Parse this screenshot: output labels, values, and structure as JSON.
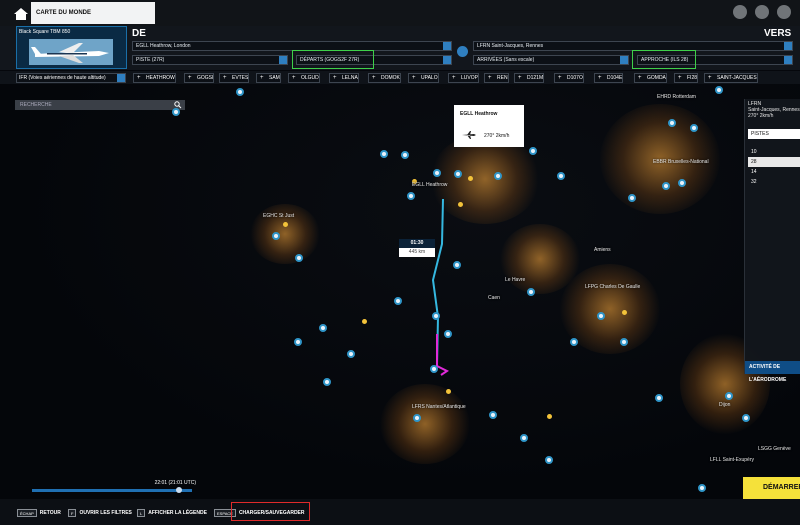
{
  "topbar": {
    "world_tab": "CARTE DU MONDE"
  },
  "aircraft": {
    "name": "Black Square TBM 850"
  },
  "departure": {
    "label": "DE",
    "airport": "EGLL Heathrow, London",
    "runway": "PISTE (27R)",
    "procedure": "DÉPARTS (GOGS2F 27R)"
  },
  "arrival": {
    "label": "VERS",
    "airport": "LFRN Saint-Jacques, Rennes",
    "type": "ARRIVÉES (Sans escale)",
    "approach": "APPROCHE (ILS 28)"
  },
  "route": {
    "flight_level": "IFR (Voies aériennes de haute altitude)",
    "waypoints": [
      "HEATHROW",
      "GOGSI",
      "EVTES",
      "SAM",
      "OLGUD",
      "LELNA",
      "DOMOK",
      "UPALO",
      "LUVOP",
      "REN",
      "D121M",
      "D107O",
      "D104E",
      "GOMDA",
      "FI28",
      "SAINT-JACQUES"
    ]
  },
  "map": {
    "search_placeholder": "RECHERCHE",
    "popup": {
      "title": "EGLL Heathrow",
      "wind": "270° 2km/h"
    },
    "leg": {
      "time": "01:30",
      "distance": "445 km"
    },
    "cities": [
      "EGHC St Just",
      "EGLL Heathrow",
      "Le Havre",
      "Caen",
      "LFPG Charles De Gaulle",
      "LFRS Nantes/Atlantique",
      "EBBR Bruxelles-National",
      "EHRD Rotterdam",
      "Dijon",
      "LSGG Genève",
      "LFLL Saint-Exupéry",
      "Amiens"
    ]
  },
  "runway_panel": {
    "airport": "LFRN",
    "name": "Saint-Jacques, Rennes",
    "wind": "270° 2km/h",
    "tab": "PISTES",
    "runways": [
      "10",
      "28",
      "14",
      "32"
    ],
    "footer": "ACTIVITÉ DE L'AÉRODROME"
  },
  "timeline": {
    "time": "22:01 (21:01 UTC)"
  },
  "start_button": "DÉMARRER",
  "bottombar": {
    "back_key": "ÉCHAP",
    "back": "RETOUR",
    "filters_key": "F",
    "filters": "OUVRIR LES FILTRES",
    "legend_key": "L",
    "legend": "AFFICHER LA LÉGENDE",
    "save_key": "ESPACE",
    "save": "CHARGER/SAUVEGARDER"
  }
}
